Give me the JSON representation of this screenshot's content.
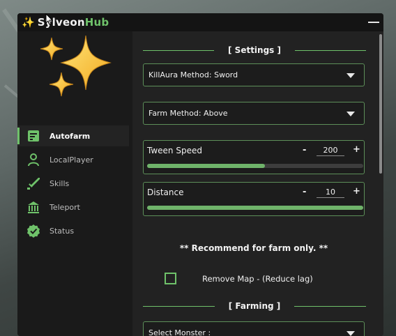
{
  "window": {
    "title_emoji": "✨",
    "title_part1": "SylveonHub",
    "title_prefix": "Sylveon",
    "title_suffix": "Hub",
    "minimize_icon": "minimize-icon"
  },
  "colors": {
    "accent": "#6fc26a",
    "panel_bg": "#222222",
    "sidebar_bg": "#1a1a1a",
    "titlebar_bg": "#141414",
    "text": "#f0f0f0"
  },
  "sidebar": {
    "logo": "sparkles-icon",
    "items": [
      {
        "label": "Autofarm",
        "icon": "clipboard-icon",
        "active": true
      },
      {
        "label": "LocalPlayer",
        "icon": "person-icon",
        "active": false
      },
      {
        "label": "Skills",
        "icon": "sword-icon",
        "active": false
      },
      {
        "label": "Teleport",
        "icon": "bank-icon",
        "active": false
      },
      {
        "label": "Status",
        "icon": "badge-check-icon",
        "active": false
      }
    ]
  },
  "main": {
    "settings_header": "[ Settings ]",
    "killaura_dropdown": "KillAura Method: Sword",
    "farm_method_dropdown": "Farm Method: Above",
    "tween_speed": {
      "label": "Tween Speed",
      "minus": "-",
      "plus": "+",
      "value": "200",
      "fill_fraction": 0.545
    },
    "distance": {
      "label": "Distance",
      "minus": "-",
      "plus": "+",
      "value": "10",
      "fill_fraction": 1.0
    },
    "note": "** Recommend for farm only. **",
    "remove_map": {
      "label": "Remove Map - (Reduce lag)",
      "checked": false
    },
    "farming_header": "[ Farming ]",
    "select_monster_dropdown": "Select Monster :"
  }
}
